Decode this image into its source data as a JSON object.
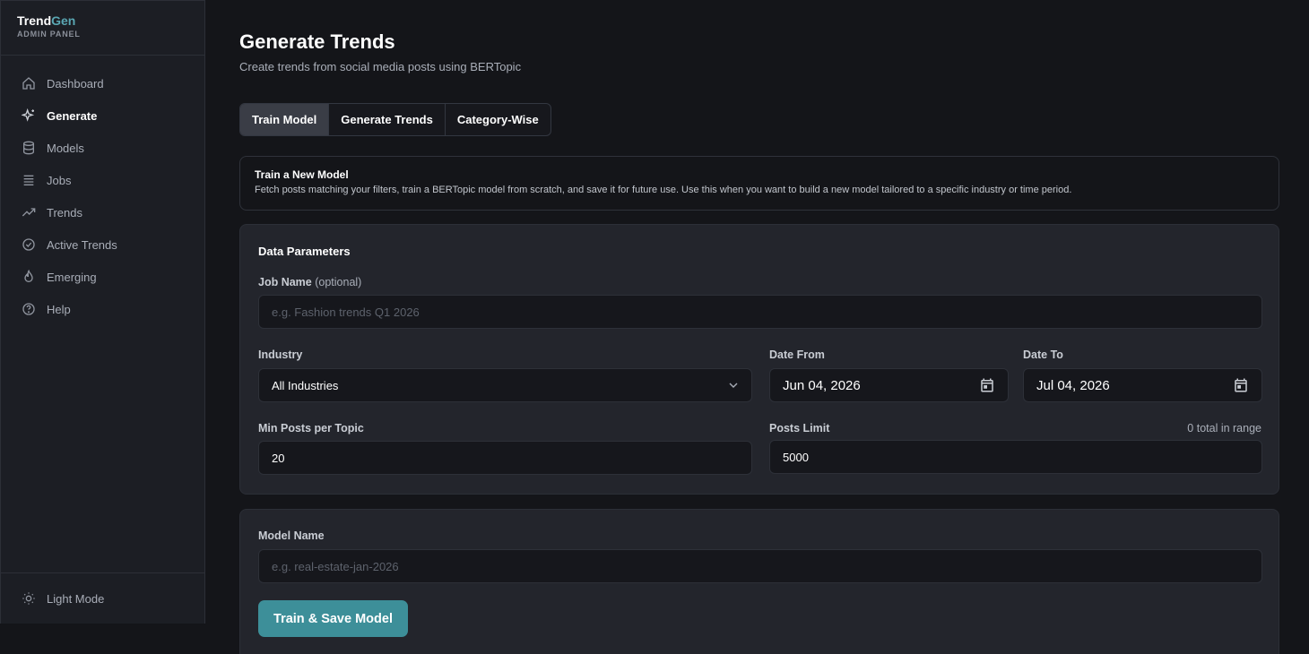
{
  "brand": {
    "name_a": "Trend",
    "name_b": "Gen",
    "subtitle": "ADMIN PANEL"
  },
  "nav": [
    {
      "label": "Dashboard",
      "icon": "home-icon"
    },
    {
      "label": "Generate",
      "icon": "sparkles-icon",
      "active": true
    },
    {
      "label": "Models",
      "icon": "database-icon"
    },
    {
      "label": "Jobs",
      "icon": "list-icon"
    },
    {
      "label": "Trends",
      "icon": "trending-up-icon"
    },
    {
      "label": "Active Trends",
      "icon": "check-circle-icon"
    },
    {
      "label": "Emerging",
      "icon": "flame-icon"
    },
    {
      "label": "Help",
      "icon": "help-circle-icon"
    }
  ],
  "footer": {
    "light_mode": "Light Mode"
  },
  "page": {
    "title": "Generate Trends",
    "subtitle": "Create trends from social media posts using BERTopic"
  },
  "tabs": [
    {
      "label": "Train Model",
      "active": true
    },
    {
      "label": "Generate Trends"
    },
    {
      "label": "Category-Wise"
    }
  ],
  "info": {
    "title": "Train a New Model",
    "text": "Fetch posts matching your filters, train a BERTopic model from scratch, and save it for future use. Use this when you want to build a new model tailored to a specific industry or time period."
  },
  "params": {
    "section_title": "Data Parameters",
    "job_name_label": "Job Name",
    "job_name_optional": "(optional)",
    "job_name_placeholder": "e.g. Fashion trends Q1 2026",
    "industry_label": "Industry",
    "industry_value": "All Industries",
    "date_from_label": "Date From",
    "date_from_value": "Jun 04, 2026",
    "date_to_label": "Date To",
    "date_to_value": "Jul 04, 2026",
    "min_posts_label": "Min Posts per Topic",
    "min_posts_value": "20",
    "posts_limit_label": "Posts Limit",
    "posts_limit_note": "0 total in range",
    "posts_limit_value": "5000"
  },
  "model": {
    "name_label": "Model Name",
    "name_placeholder": "e.g. real-estate-jan-2026",
    "button": "Train & Save Model"
  },
  "colors": {
    "accent": "#3d8f99",
    "background": "#141519",
    "sidebar": "#1c1e24",
    "card": "#23252c"
  }
}
